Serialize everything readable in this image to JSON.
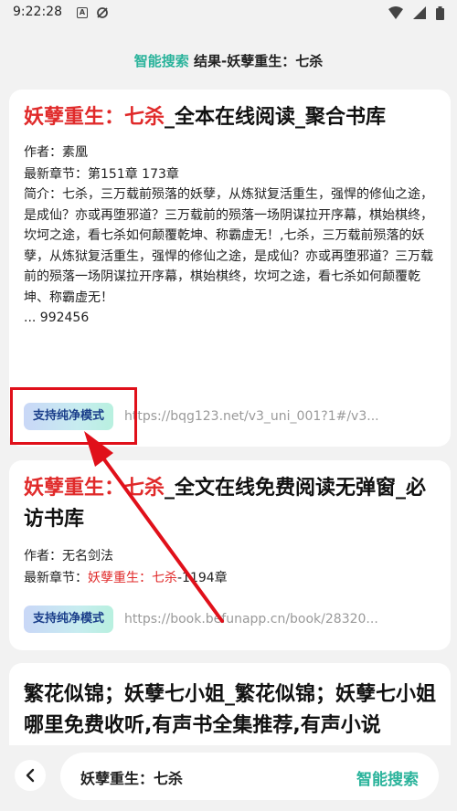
{
  "status": {
    "time": "9:22:28",
    "icon_a": "A"
  },
  "header": {
    "accent": "智能搜索",
    "rest": " 结果-妖孽重生：七杀"
  },
  "results": [
    {
      "title_hl": "妖孽重生：七杀",
      "title_rest": "_全本在线阅读_聚合书库",
      "author": "作者：素凰",
      "latest_label": "最新章节：",
      "latest_value": "第151章 173章",
      "intro": "简介：七杀，三万载前殒落的妖孽，从炼狱复活重生，强悍的修仙之途，是成仙？亦或再堕邪道？三万载前的殒落一场阴谋拉开序幕，棋始棋终，坎坷之途，看七杀如何颠覆乾坤、称霸虚无！,七杀，三万载前殒落的妖孽，从炼狱复活重生，强悍的修仙之途，是成仙？亦或再堕邪道？三万载前的殒落一场阴谋拉开序幕，棋始棋终，坎坷之途，看七杀如何颠覆乾坤、称霸虚无！",
      "extra": "... 992456",
      "pure_label": "支持纯净模式",
      "url": "https://bqg123.net/v3_uni_001?1#/v3..."
    },
    {
      "title_hl": "妖孽重生：七杀",
      "title_rest": "_全文在线免费阅读无弹窗_必访书库",
      "author": "作者：无名剑法",
      "latest_label": "最新章节：",
      "latest_hl": "妖孽重生：七杀",
      "latest_rest": "-1194章",
      "pure_label": "支持纯净模式",
      "url": "https://book.befunapp.cn/book/28320..."
    },
    {
      "title": "繁花似锦；妖孽七小姐_繁花似锦；妖孽七小姐哪里免费收听,有声书全集推荐,有声小说"
    }
  ],
  "bottom": {
    "query": "妖孽重生：七杀",
    "search_label": "智能搜索"
  },
  "colors": {
    "accent": "#2ab39b",
    "highlight": "#e02a2a",
    "annotation": "#e0101a"
  }
}
